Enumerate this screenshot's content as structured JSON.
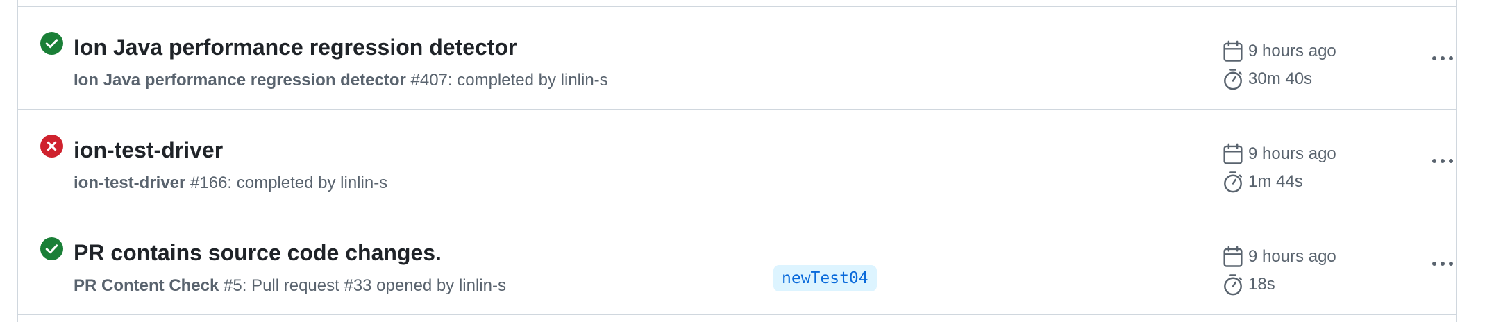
{
  "colors": {
    "success": "#1a7f37",
    "failure": "#cf222e",
    "muted_text": "#59636e",
    "branch_bg": "#ddf4ff",
    "branch_text": "#0969da"
  },
  "runs": [
    {
      "status": "success",
      "status_icon": "check-circle-icon",
      "title": "Ion Java performance regression detector",
      "workflow": "Ion Java performance regression detector",
      "run_detail": " #407: completed by linlin-s",
      "branch": "",
      "started": "9 hours ago",
      "duration": "30m 40s"
    },
    {
      "status": "failure",
      "status_icon": "x-circle-icon",
      "title": "ion-test-driver",
      "workflow": "ion-test-driver",
      "run_detail": " #166: completed by linlin-s",
      "branch": "",
      "started": "9 hours ago",
      "duration": "1m 44s"
    },
    {
      "status": "success",
      "status_icon": "check-circle-icon",
      "title": "PR contains source code changes.",
      "workflow": "PR Content Check",
      "run_detail": " #5: Pull request #33 opened by linlin-s",
      "branch": "newTest04",
      "started": "9 hours ago",
      "duration": "18s"
    }
  ]
}
